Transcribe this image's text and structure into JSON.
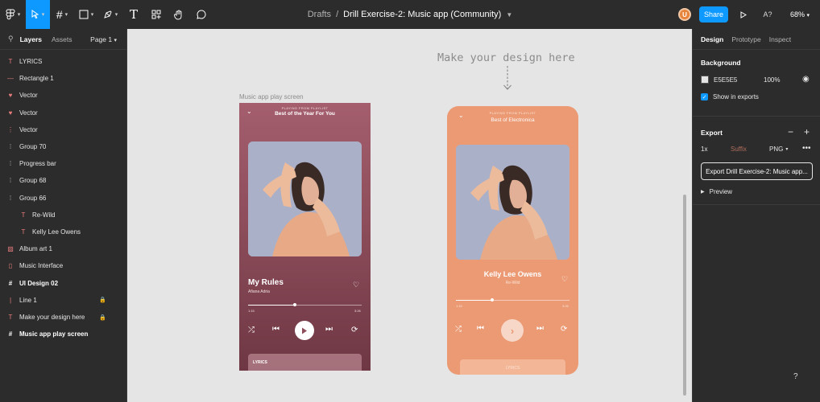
{
  "toolbar": {
    "breadcrumb_drafts": "Drafts",
    "breadcrumb_sep": "/",
    "file_name": "Drill Exercise-2: Music app (Community)",
    "avatar_initial": "U",
    "share_label": "Share",
    "a7_label": "A?",
    "zoom": "68%"
  },
  "left_panel": {
    "tabs": [
      "Layers",
      "Assets"
    ],
    "page": "Page 1",
    "layers": [
      {
        "icon": "text-icon",
        "glyph": "T",
        "label": "LYRICS"
      },
      {
        "icon": "line-icon",
        "glyph": "—",
        "label": "Rectangle 1"
      },
      {
        "icon": "vector-icon",
        "glyph": "♥",
        "label": "Vector"
      },
      {
        "icon": "vector-icon",
        "glyph": "♥",
        "label": "Vector"
      },
      {
        "icon": "vector-icon",
        "glyph": "⋮",
        "label": "Vector"
      },
      {
        "icon": "group-icon",
        "glyph": "⁞",
        "label": "Group 70"
      },
      {
        "icon": "group-icon",
        "glyph": "⁞",
        "label": "Progress bar"
      },
      {
        "icon": "group-icon",
        "glyph": "⁞",
        "label": "Group 68"
      },
      {
        "icon": "group-icon",
        "glyph": "⁞",
        "label": "Group 66"
      },
      {
        "icon": "text-icon",
        "glyph": "T",
        "label": "Re-Wild"
      },
      {
        "icon": "text-icon",
        "glyph": "T",
        "label": "Kelly Lee Owens"
      },
      {
        "icon": "image-icon",
        "glyph": "▧",
        "label": "Album art 1"
      },
      {
        "icon": "rect-icon",
        "glyph": "▯",
        "label": "Music Interface"
      },
      {
        "icon": "frame-icon",
        "glyph": "#",
        "label": "UI Design 02"
      },
      {
        "icon": "line-icon",
        "glyph": "|",
        "label": "Line 1"
      },
      {
        "icon": "text-icon",
        "glyph": "T",
        "label": "Make your design here"
      },
      {
        "icon": "frame-icon",
        "glyph": "#",
        "label": "Music app play screen"
      }
    ]
  },
  "right_panel": {
    "tabs": [
      "Design",
      "Prototype",
      "Inspect"
    ],
    "background_title": "Background",
    "bg_hex": "E5E5E5",
    "bg_opacity": "100%",
    "show_in_exports": "Show in exports",
    "export_title": "Export",
    "scale": "1x",
    "suffix": "Suffix",
    "format": "PNG",
    "export_button": "Export Drill Exercise-2: Music app...",
    "preview": "Preview"
  },
  "canvas": {
    "make_design": "Make your design here",
    "frame_label": "Music app play screen",
    "phone1": {
      "playing_from": "PLAYING FROM PLAYLIST",
      "playlist": "Best of the Year For You",
      "song": "My Rules",
      "artist": "Afiana Adria",
      "time_start": "1:15",
      "time_end": "3:26",
      "progress": 0.41,
      "lyrics": "LYRICS"
    },
    "phone2": {
      "playing_from": "PLAYING FROM PLAYLIST",
      "playlist": "Best of Electronica",
      "song": "Kelly Lee Owens",
      "artist": "Re-Wild",
      "time_start": "1:15",
      "time_end": "3:26",
      "progress": 0.32,
      "lyrics": "LYRICS"
    }
  },
  "help": "?"
}
